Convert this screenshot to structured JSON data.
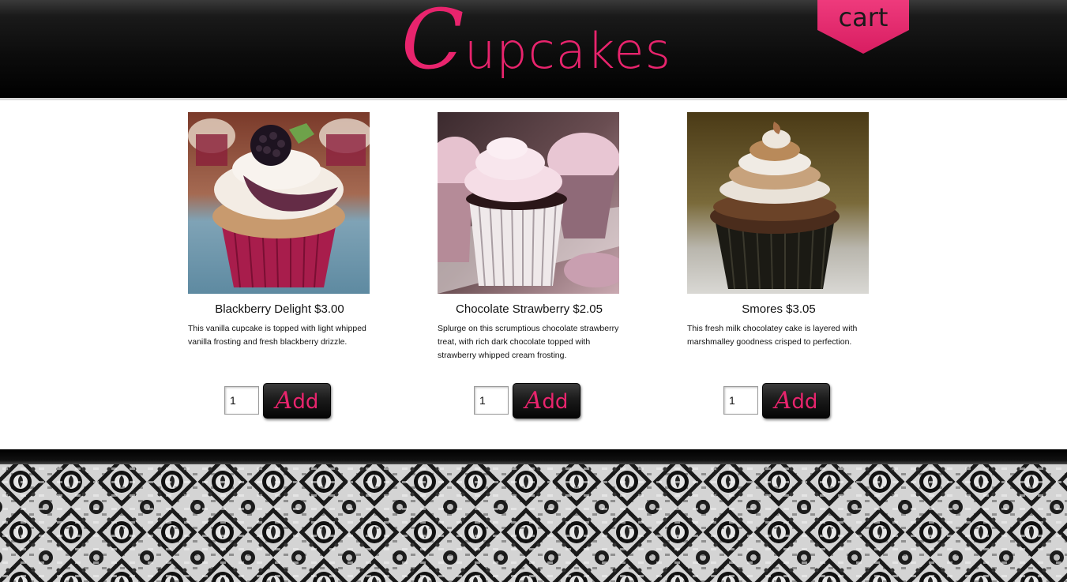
{
  "header": {
    "logo_initial": "C",
    "logo_rest": "upcakes",
    "cart_label": "cart"
  },
  "colors": {
    "brand_pink": "#e8246d",
    "header_black": "#000000"
  },
  "products": [
    {
      "title": "Blackberry Delight $3.00",
      "description": "This vanilla cupcake is topped with light whipped vanilla frosting and fresh blackberry drizzle.",
      "quantity": "1",
      "add_initial": "A",
      "add_rest": "dd",
      "image_icon": "blackberry-cupcake-photo"
    },
    {
      "title": "Chocolate Strawberry $2.05",
      "description": "Splurge on this scrumptious chocolate strawberry treat, with rich dark chocolate topped with strawberry whipped cream frosting.",
      "quantity": "1",
      "add_initial": "A",
      "add_rest": "dd",
      "image_icon": "chocolate-strawberry-cupcake-photo"
    },
    {
      "title": "Smores $3.05",
      "description": "This fresh milk chocolatey cake is layered with marshmalley goodness crisped to perfection.",
      "quantity": "1",
      "add_initial": "A",
      "add_rest": "dd",
      "image_icon": "smores-cupcake-photo"
    }
  ]
}
